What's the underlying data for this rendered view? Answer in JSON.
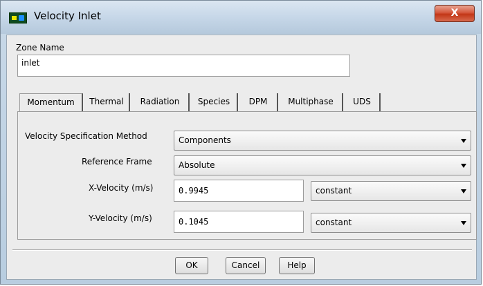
{
  "window": {
    "title": "Velocity Inlet",
    "close_label": "X"
  },
  "zone": {
    "label": "Zone Name",
    "value": "inlet"
  },
  "tabs": [
    {
      "label": "Momentum",
      "active": true
    },
    {
      "label": "Thermal",
      "active": false
    },
    {
      "label": "Radiation",
      "active": false
    },
    {
      "label": "Species",
      "active": false
    },
    {
      "label": "DPM",
      "active": false
    },
    {
      "label": "Multiphase",
      "active": false
    },
    {
      "label": "UDS",
      "active": false
    }
  ],
  "momentum": {
    "velocity_spec_label": "Velocity Specification Method",
    "velocity_spec_value": "Components",
    "reference_frame_label": "Reference Frame",
    "reference_frame_value": "Absolute",
    "x_velocity_label": "X-Velocity (m/s)",
    "x_velocity_value": "0.9945",
    "x_velocity_profile": "constant",
    "y_velocity_label": "Y-Velocity (m/s)",
    "y_velocity_value": "0.1045",
    "y_velocity_profile": "constant"
  },
  "buttons": {
    "ok": "OK",
    "cancel": "Cancel",
    "help": "Help"
  },
  "colors": {
    "title_bar": "#c6d7e8",
    "close_button": "#c23717",
    "dialog_background": "#ececec"
  }
}
